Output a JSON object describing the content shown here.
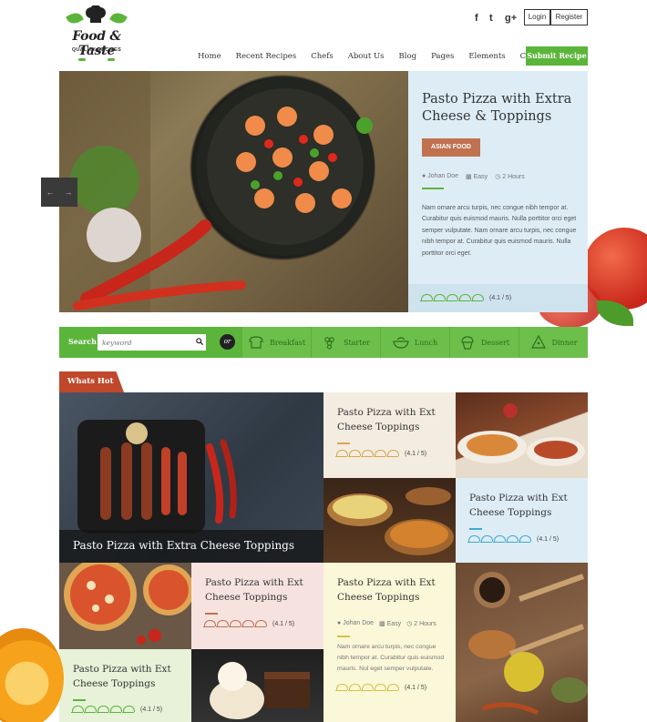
{
  "brand": {
    "name": "Food & Taste",
    "tagline": "QUALITY RECIPES"
  },
  "social": [
    "f",
    "t",
    "g+"
  ],
  "auth": {
    "login": "Login",
    "register": "Register"
  },
  "nav": [
    "Home",
    "Recent Recipes",
    "Chefs",
    "About Us",
    "Blog",
    "Pages",
    "Elements",
    "Contact"
  ],
  "submit_label": "Submit Recipe",
  "hero": {
    "title": "Pasto Pizza with Extra Cheese & Toppings",
    "category": "ASIAN FOOD",
    "author": "Johan Doe",
    "difficulty": "Easy",
    "time": "2 Hours",
    "description": "Nam ornare arcu turpis, nec congue nibh tempor at. Curabitur quis euismod mauris. Nulla porttitor orci eget semper vulputate. Nam ornare arcu turpis, nec congue nibh tempor at. Curabitur quis euismod mauris. Nulla porttitor orci eget.",
    "rating": "(4.1 / 5)"
  },
  "search": {
    "label": "Search",
    "placeholder": "keyword",
    "or": "or",
    "meals": [
      "Breakfast",
      "Starter",
      "Lunch",
      "Dessert",
      "Dinner"
    ]
  },
  "hot": {
    "label": "Whats Hot",
    "big_title": "Pasto Pizza with Extra Cheese Toppings",
    "tiles": [
      {
        "title": "Pasto Pizza with Ext Cheese Toppings",
        "rating": "(4.1 / 5)"
      },
      {
        "title": "Pasto Pizza with Ext Cheese Toppings",
        "rating": "(4.1 / 5)"
      },
      {
        "title": "Pasto Pizza with Ext Cheese Toppings",
        "rating": "(4.1 / 5)"
      },
      {
        "title": "Pasto Pizza with Ext Cheese Toppings",
        "rating": "(4.1 / 5)",
        "author": "Johan Doe",
        "difficulty": "Easy",
        "time": "2 Hours",
        "description": "Nam ornare arcu turpis, nec congue nibh tempor at. Curabitur quis euismod mauris. Nul eget semper vulputate."
      },
      {
        "title": "Pasto Pizza with Ext Cheese Toppings",
        "rating": "(4.1 / 5)"
      }
    ]
  },
  "colors": {
    "green": "#5bb53b",
    "rust": "#c0724f",
    "hot_red": "#c0472b",
    "light_blue": "#deedf5"
  }
}
